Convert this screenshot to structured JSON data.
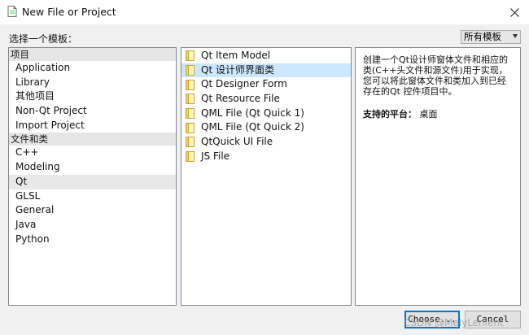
{
  "window": {
    "title": "New File or Project",
    "app_icon": "qt-creator-icon",
    "close_icon": "close-icon"
  },
  "prompt": "选择一个模板：",
  "filter": {
    "selected": "所有模板"
  },
  "categories": {
    "groups": [
      {
        "header": "项目",
        "items": [
          "Application",
          "Library",
          "其他项目",
          "Non-Qt Project",
          "Import Project"
        ]
      },
      {
        "header": "文件和类",
        "items": [
          "C++",
          "Modeling",
          "Qt",
          "GLSL",
          "General",
          "Java",
          "Python"
        ]
      }
    ],
    "selected": "Qt"
  },
  "templates": {
    "items": [
      "Qt Item Model",
      "Qt 设计师界面类",
      "Qt Designer Form",
      "Qt Resource File",
      "QML File (Qt Quick 1)",
      "QML File (Qt Quick 2)",
      "QtQuick UI File",
      "JS File"
    ],
    "selected": "Qt 设计师界面类",
    "icon": "folder-icon"
  },
  "description": {
    "lines": [
      "创建一个Qt设计师窗体文件和相应的",
      "类(C++头文件和源文件)用于实现，",
      "您可以将此窗体文件和类加入到已经",
      "存在的Qt 控件项目中。"
    ],
    "platform_label": "支持的平台：",
    "platform_value": "桌面"
  },
  "buttons": {
    "choose": "Choose...",
    "cancel": "Cancel"
  },
  "watermark": "CSDN @MelyLenient",
  "colors": {
    "selection": "#cce8ff",
    "default_button_border": "#0078d7",
    "group_header_bg": "#e6e6e6"
  }
}
